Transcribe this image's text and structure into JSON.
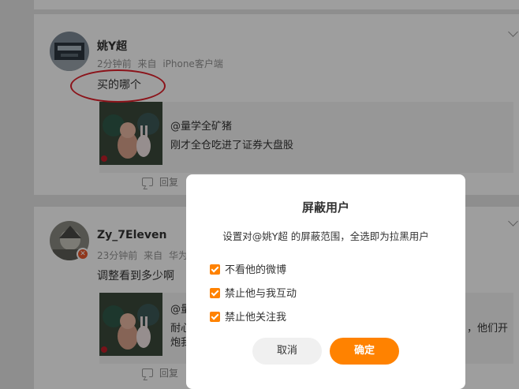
{
  "feed": {
    "posts": [
      {
        "username": "姚Y超",
        "time": "2分钟前",
        "source_prefix": "来自",
        "source": "iPhone客户端",
        "text": "买的哪个",
        "repost": {
          "author": "@量学全矿猪",
          "text": "刚才全仓吃进了证券大盘股"
        },
        "reply_label": "回复"
      },
      {
        "username": "Zy_7Eleven",
        "time": "23分钟前",
        "source_prefix": "来自",
        "source": "华为",
        "text": "调整看到多少啊",
        "repost": {
          "author_partial": "@量",
          "text_line1_left": "耐心",
          "text_line1_right": "，他们开",
          "text_line2_left": "炮我"
        },
        "reply_label": "回复"
      }
    ]
  },
  "annotation": {
    "color": "#e1202a"
  },
  "modal": {
    "title": "屏蔽用户",
    "description": "设置对@姚Y超 的屏蔽范围，全选即为拉黑用户",
    "options": [
      {
        "label": "不看他的微博",
        "checked": true
      },
      {
        "label": "禁止他与我互动",
        "checked": true
      },
      {
        "label": "禁止他关注我",
        "checked": true
      }
    ],
    "cancel_label": "取消",
    "confirm_label": "确定",
    "accent_color": "#ff8200"
  }
}
